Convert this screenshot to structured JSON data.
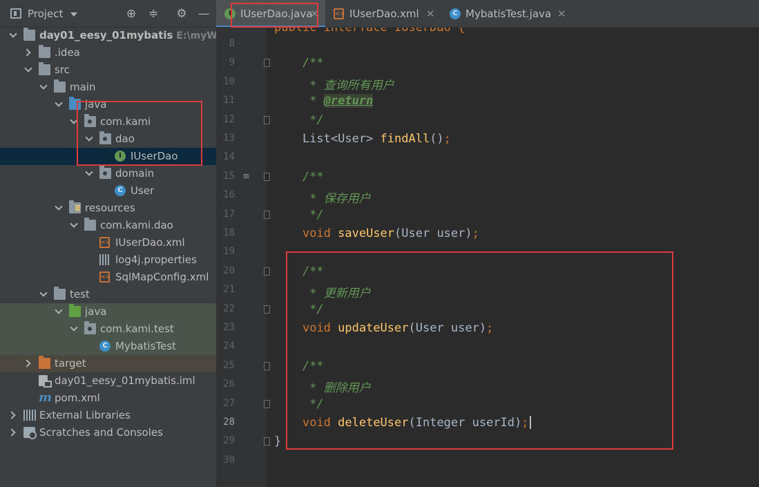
{
  "project_panel": {
    "title": "Project",
    "tools": {
      "locate": "⊕",
      "collapse": "≑",
      "settings": "⚙",
      "hide": "—"
    },
    "tree": [
      {
        "label": "day01_eesy_01mybatis",
        "suffix": "E:\\myWork",
        "icon": "module-folder-icon",
        "arrow": "down"
      },
      {
        "label": ".idea",
        "icon": "folder-icon",
        "arrow": "right"
      },
      {
        "label": "src",
        "icon": "folder-icon",
        "arrow": "down"
      },
      {
        "label": "main",
        "icon": "folder-icon",
        "arrow": "down"
      },
      {
        "label": "java",
        "icon": "source-folder-icon",
        "arrow": "down"
      },
      {
        "label": "com.kami",
        "icon": "package-icon",
        "arrow": "down"
      },
      {
        "label": "dao",
        "icon": "package-icon",
        "arrow": "down"
      },
      {
        "label": "IUserDao",
        "icon": "interface-icon",
        "icon_text": "I",
        "selected": true
      },
      {
        "label": "domain",
        "icon": "package-icon",
        "arrow": "down"
      },
      {
        "label": "User",
        "icon": "class-icon",
        "icon_text": "C"
      },
      {
        "label": "resources",
        "icon": "resources-folder-icon",
        "arrow": "down"
      },
      {
        "label": "com.kami.dao",
        "icon": "folder-icon",
        "arrow": "down"
      },
      {
        "label": "IUserDao.xml",
        "icon": "xml-file-icon",
        "icon_text": "<>"
      },
      {
        "label": "log4j.properties",
        "icon": "properties-file-icon"
      },
      {
        "label": "SqlMapConfig.xml",
        "icon": "xml-file-icon",
        "icon_text": "<>"
      },
      {
        "label": "test",
        "icon": "folder-icon",
        "arrow": "down"
      },
      {
        "label": "java",
        "icon": "test-source-folder-icon",
        "arrow": "down"
      },
      {
        "label": "com.kami.test",
        "icon": "package-icon",
        "arrow": "down"
      },
      {
        "label": "MybatisTest",
        "icon": "test-class-icon",
        "icon_text": "C"
      },
      {
        "label": "target",
        "icon": "excluded-folder-icon",
        "arrow": "right"
      },
      {
        "label": "day01_eesy_01mybatis.iml",
        "icon": "iml-file-icon"
      },
      {
        "label": "pom.xml",
        "icon": "maven-icon",
        "icon_text": "m"
      },
      {
        "label": "External Libraries",
        "icon": "libraries-icon",
        "arrow": "right"
      },
      {
        "label": "Scratches and Consoles",
        "icon": "scratches-icon",
        "arrow": "right"
      }
    ]
  },
  "editor": {
    "tabs": [
      {
        "label": "IUserDao.java",
        "icon_text": "I",
        "active": true
      },
      {
        "label": "IUserDao.xml",
        "icon_text": "<>",
        "active": false
      },
      {
        "label": "MybatisTest.java",
        "icon_text": "C",
        "active": false
      }
    ],
    "close_glyph": "✕",
    "partial_top_line": "public interface IUserDao {",
    "lines": [
      {
        "n": "8",
        "segments": []
      },
      {
        "n": "9",
        "fold": true,
        "segments": [
          {
            "t": "    /**",
            "c": "cm"
          }
        ]
      },
      {
        "n": "10",
        "segments": [
          {
            "t": "     * 查询所有用户",
            "c": "cm"
          }
        ]
      },
      {
        "n": "11",
        "segments": [
          {
            "t": "     * ",
            "c": "cm"
          },
          {
            "t": "@return",
            "c": "cm-tag"
          }
        ]
      },
      {
        "n": "12",
        "fold": true,
        "segments": [
          {
            "t": "     */",
            "c": "cm"
          }
        ]
      },
      {
        "n": "13",
        "segments": [
          {
            "t": "    List<User> ",
            "c": ""
          },
          {
            "t": "findAll",
            "c": "fn"
          },
          {
            "t": "()",
            "c": ""
          },
          {
            "t": ";",
            "c": "kw"
          }
        ]
      },
      {
        "n": "14",
        "segments": []
      },
      {
        "n": "15",
        "fold": true,
        "impl": true,
        "segments": [
          {
            "t": "    /**",
            "c": "cm"
          }
        ]
      },
      {
        "n": "16",
        "segments": [
          {
            "t": "     * 保存用户",
            "c": "cm"
          }
        ]
      },
      {
        "n": "17",
        "fold": true,
        "segments": [
          {
            "t": "     */",
            "c": "cm"
          }
        ]
      },
      {
        "n": "18",
        "segments": [
          {
            "t": "    ",
            "c": ""
          },
          {
            "t": "void ",
            "c": "kw"
          },
          {
            "t": "saveUser",
            "c": "fn"
          },
          {
            "t": "(User user)",
            "c": ""
          },
          {
            "t": ";",
            "c": "kw"
          }
        ]
      },
      {
        "n": "19",
        "segments": []
      },
      {
        "n": "20",
        "fold": true,
        "segments": [
          {
            "t": "    /**",
            "c": "cm"
          }
        ]
      },
      {
        "n": "21",
        "segments": [
          {
            "t": "     * 更新用户",
            "c": "cm"
          }
        ]
      },
      {
        "n": "22",
        "fold": true,
        "segments": [
          {
            "t": "     */",
            "c": "cm"
          }
        ]
      },
      {
        "n": "23",
        "segments": [
          {
            "t": "    ",
            "c": ""
          },
          {
            "t": "void ",
            "c": "kw"
          },
          {
            "t": "updateUser",
            "c": "fn"
          },
          {
            "t": "(User user)",
            "c": ""
          },
          {
            "t": ";",
            "c": "kw"
          }
        ]
      },
      {
        "n": "24",
        "segments": []
      },
      {
        "n": "25",
        "fold": true,
        "segments": [
          {
            "t": "    /**",
            "c": "cm"
          }
        ]
      },
      {
        "n": "26",
        "segments": [
          {
            "t": "     * 删除用户",
            "c": "cm"
          }
        ]
      },
      {
        "n": "27",
        "fold": true,
        "segments": [
          {
            "t": "     */",
            "c": "cm"
          }
        ]
      },
      {
        "n": "28",
        "current": true,
        "segments": [
          {
            "t": "    ",
            "c": ""
          },
          {
            "t": "void ",
            "c": "kw"
          },
          {
            "t": "deleteUser",
            "c": "fn"
          },
          {
            "t": "(Integer userId)",
            "c": ""
          },
          {
            "t": ";",
            "c": "kw"
          }
        ],
        "caret": true
      },
      {
        "n": "29",
        "fold": true,
        "segments": [
          {
            "t": "}",
            "c": ""
          }
        ]
      },
      {
        "n": "30",
        "segments": []
      }
    ]
  },
  "colors": {
    "annotation_red": "#e03b3b",
    "selection": "#0d293e",
    "keyword": "#cc7832",
    "method": "#ffc66d",
    "comment": "#629755"
  }
}
